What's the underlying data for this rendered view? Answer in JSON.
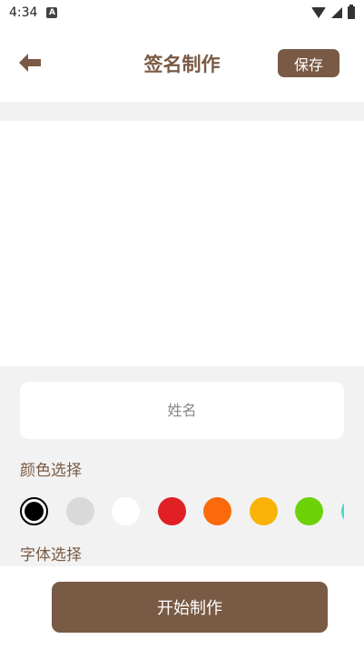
{
  "status_bar": {
    "time": "4:34",
    "notification_letter": "A"
  },
  "header": {
    "title": "签名制作",
    "save_label": "保存"
  },
  "name_input": {
    "placeholder": "姓名",
    "value": ""
  },
  "color_section": {
    "label": "颜色选择",
    "selected_index": 0,
    "colors": [
      "#000000",
      "#d9d9d9",
      "#ffffff",
      "#e12025",
      "#fa6a0a",
      "#f9b208",
      "#6cd207",
      "#4fd6c6"
    ]
  },
  "font_section": {
    "label": "字体选择"
  },
  "start_button": {
    "label": "开始制作"
  }
}
